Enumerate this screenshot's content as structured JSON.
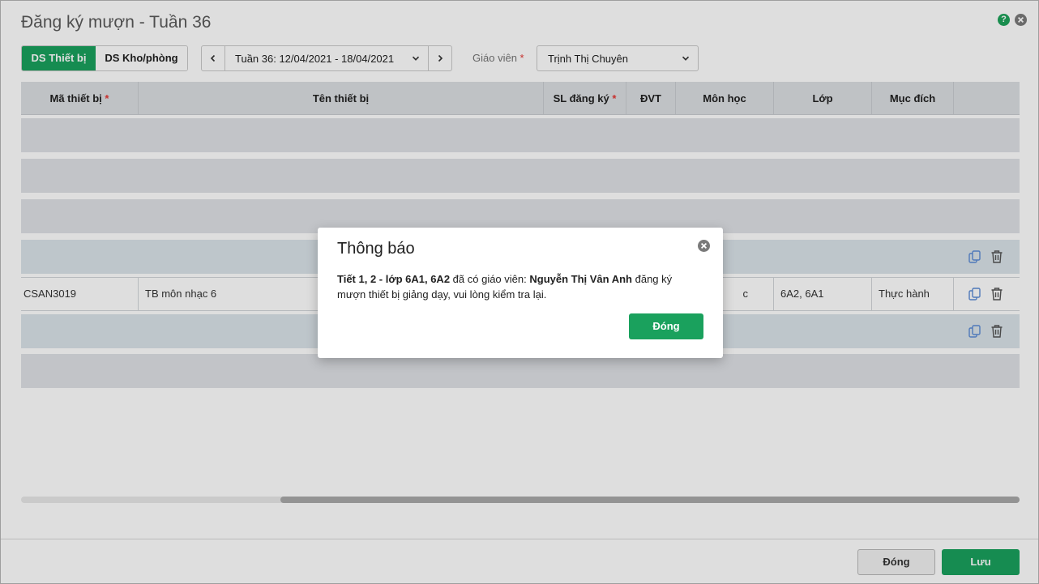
{
  "window": {
    "title": "Đăng ký mượn - Tuần 36"
  },
  "toolbar": {
    "tab_devices": "DS Thiết bị",
    "tab_rooms": "DS Kho/phòng",
    "week_label": "Tuần 36: 12/04/2021 - 18/04/2021",
    "teacher_label": "Giáo viên",
    "required_mark": "*",
    "teacher_value": "Trịnh Thị Chuyên"
  },
  "help_icon": "?",
  "grid": {
    "columns": [
      "Mã thiết bị",
      "Tên thiết bị",
      "SL đăng ký",
      "ĐVT",
      "Môn học",
      "Lớp",
      "Mục đích"
    ],
    "row": {
      "code": "CSAN3019",
      "name": "TB môn nhạc 6",
      "subject_partial": "c",
      "class": "6A2, 6A1",
      "purpose": "Thực hành"
    }
  },
  "footer": {
    "close_label": "Đóng",
    "save_label": "Lưu"
  },
  "dialog": {
    "title": "Thông báo",
    "msg_bold1": "Tiết 1, 2 - lớp 6A1, 6A2",
    "msg_text1": " đã có giáo viên: ",
    "msg_bold2": "Nguyễn Thị Vân Anh",
    "msg_text2": " đăng ký mượn thiết bị giảng dạy, vui lòng kiểm tra lại.",
    "button": "Đóng"
  },
  "colors": {
    "accent": "#1aa15d",
    "required": "#e53935",
    "icon_blue": "#5b8bd6"
  }
}
